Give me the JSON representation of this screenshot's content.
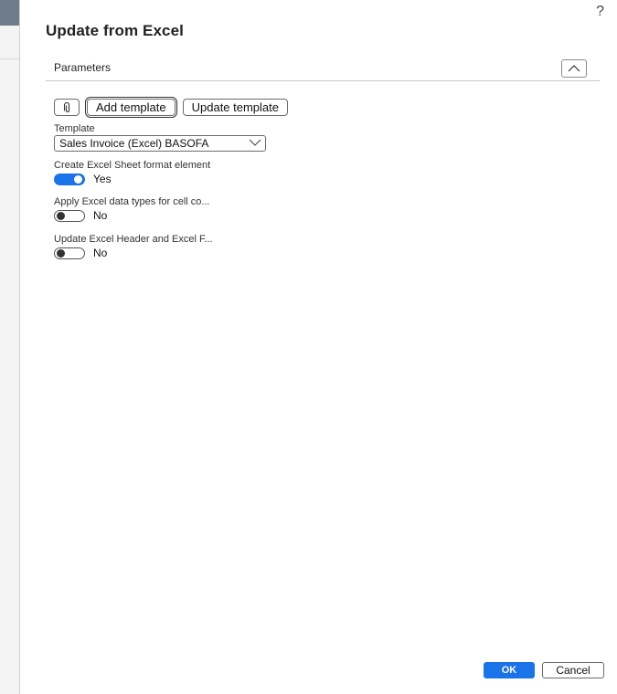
{
  "dialog": {
    "title": "Update from Excel",
    "help_glyph": "?"
  },
  "parameters": {
    "section_title": "Parameters",
    "toolbar": {
      "attach_icon": "paperclip-icon",
      "add_template_label": "Add template",
      "update_template_label": "Update template"
    },
    "template": {
      "label": "Template",
      "value": "Sales Invoice (Excel) BASOFA"
    },
    "create_sheet_format": {
      "label": "Create Excel Sheet format element",
      "state": "on",
      "value_text": "Yes"
    },
    "apply_data_types": {
      "label": "Apply Excel data types for cell co...",
      "state": "off",
      "value_text": "No"
    },
    "update_header_footer": {
      "label": "Update Excel Header and Excel F...",
      "state": "off",
      "value_text": "No"
    }
  },
  "footer": {
    "ok_label": "OK",
    "cancel_label": "Cancel"
  },
  "colors": {
    "accent": "#1a73e8",
    "backdrop_header": "#6f7c8a"
  }
}
